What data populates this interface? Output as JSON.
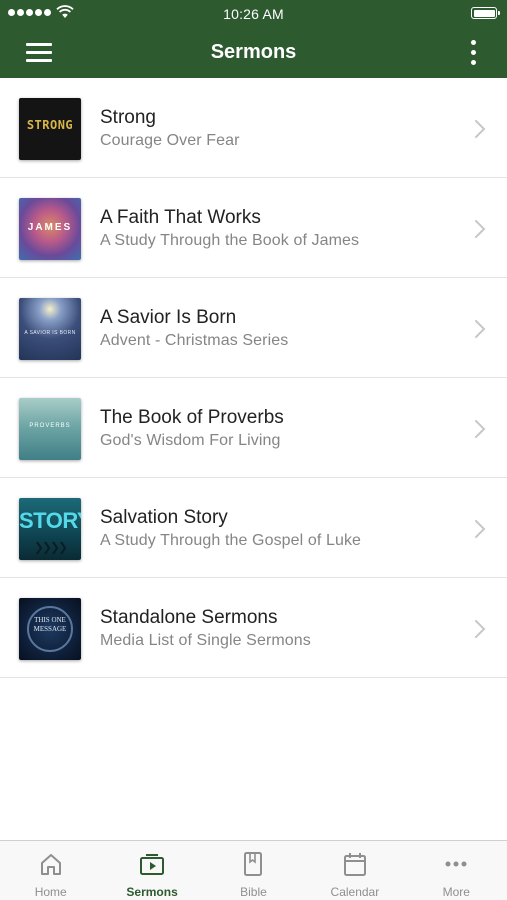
{
  "status_bar": {
    "time": "10:26 AM"
  },
  "nav": {
    "title": "Sermons"
  },
  "sermons": [
    {
      "title": "Strong",
      "subtitle": "Courage Over Fear",
      "art_text": "STRONG"
    },
    {
      "title": "A Faith That Works",
      "subtitle": "A Study Through the Book of James",
      "art_text": "JAMES"
    },
    {
      "title": "A Savior Is Born",
      "subtitle": "Advent - Christmas Series",
      "art_text": "A SAVIOR IS BORN"
    },
    {
      "title": "The Book of Proverbs",
      "subtitle": "God's Wisdom For Living",
      "art_text": "PROVERBS"
    },
    {
      "title": "Salvation Story",
      "subtitle": "A Study Through the Gospel of Luke",
      "art_text": "STORY"
    },
    {
      "title": "Standalone Sermons",
      "subtitle": "Media List of Single Sermons",
      "art_text": "THIS ONE MESSAGE"
    }
  ],
  "tabs": [
    {
      "label": "Home",
      "icon": "home-icon",
      "active": false
    },
    {
      "label": "Sermons",
      "icon": "sermons-icon",
      "active": true
    },
    {
      "label": "Bible",
      "icon": "bible-icon",
      "active": false
    },
    {
      "label": "Calendar",
      "icon": "calendar-icon",
      "active": false
    },
    {
      "label": "More",
      "icon": "more-icon",
      "active": false
    }
  ],
  "colors": {
    "brand_green": "#2d5a2f",
    "tab_inactive": "#8f8f8f",
    "subtitle_gray": "#858585"
  }
}
